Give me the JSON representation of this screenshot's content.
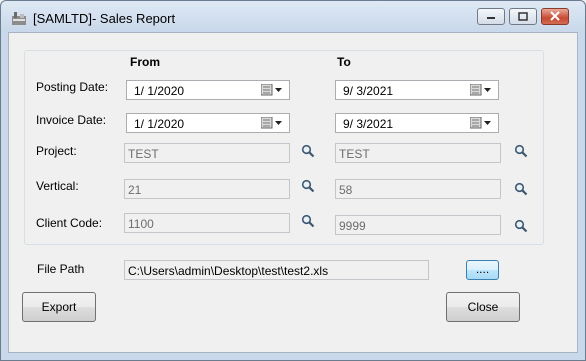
{
  "window": {
    "title": "[SAMLTD]- Sales Report"
  },
  "headers": {
    "from": "From",
    "to": "To"
  },
  "posting_date": {
    "label": "Posting Date:",
    "from": "1/  1/2020",
    "to": "9/  3/2021"
  },
  "invoice_date": {
    "label": "Invoice Date:",
    "from": "1/  1/2020",
    "to": "9/  3/2021"
  },
  "project": {
    "label": "Project:",
    "from": "TEST",
    "to": "TEST"
  },
  "vertical": {
    "label": "Vertical:",
    "from": "21",
    "to": "58"
  },
  "client_code": {
    "label": "Client Code:",
    "from": "1100",
    "to": "9999"
  },
  "file_path": {
    "label": "File Path",
    "value": "C:\\Users\\admin\\Desktop\\test\\test2.xls",
    "browse_label": "...."
  },
  "buttons": {
    "export": "Export",
    "close": "Close"
  },
  "icons": {
    "app": "report-app-icon",
    "calendar": "calendar-dropdown-icon",
    "search": "magnifier-icon"
  }
}
